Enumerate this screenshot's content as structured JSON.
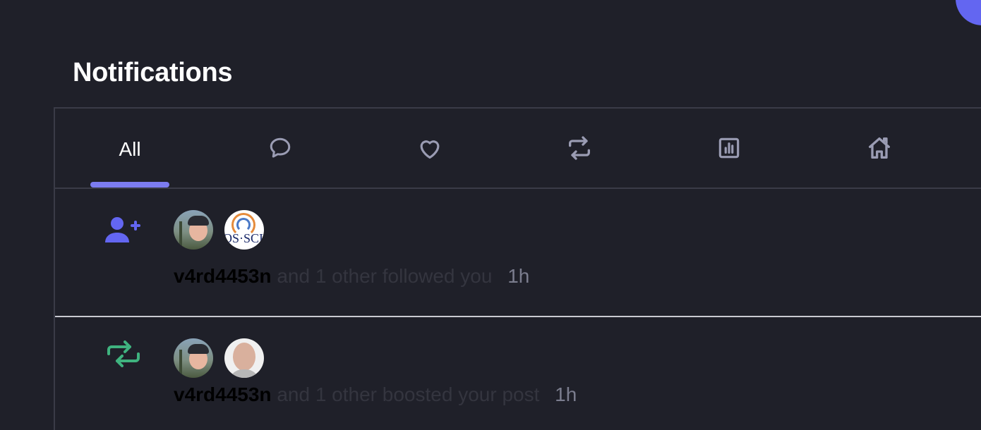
{
  "page": {
    "title": "Notifications"
  },
  "tabs": {
    "all_label": "All",
    "icons": [
      "comment-icon",
      "heart-icon",
      "boost-icon",
      "poll-icon",
      "home-icon"
    ]
  },
  "notifications": [
    {
      "type_icon": "user-plus-icon",
      "type_icon_color": "#6366f1",
      "avatars": [
        "avatar-person-cap",
        "avatar-os-sci-logo"
      ],
      "avatar_logo_text": "OS·SCI",
      "user": "v4rd4453n",
      "action": "and 1 other followed you",
      "time": "1h"
    },
    {
      "type_icon": "boost-icon",
      "type_icon_color": "#3fb37f",
      "avatars": [
        "avatar-person-cap",
        "avatar-bald-man"
      ],
      "user": "v4rd4453n",
      "action": "and 1 other boosted your post",
      "time": "1h"
    }
  ],
  "colors": {
    "background": "#1f2029",
    "accent": "#7c7cf0",
    "divider": "#3a3b47"
  }
}
